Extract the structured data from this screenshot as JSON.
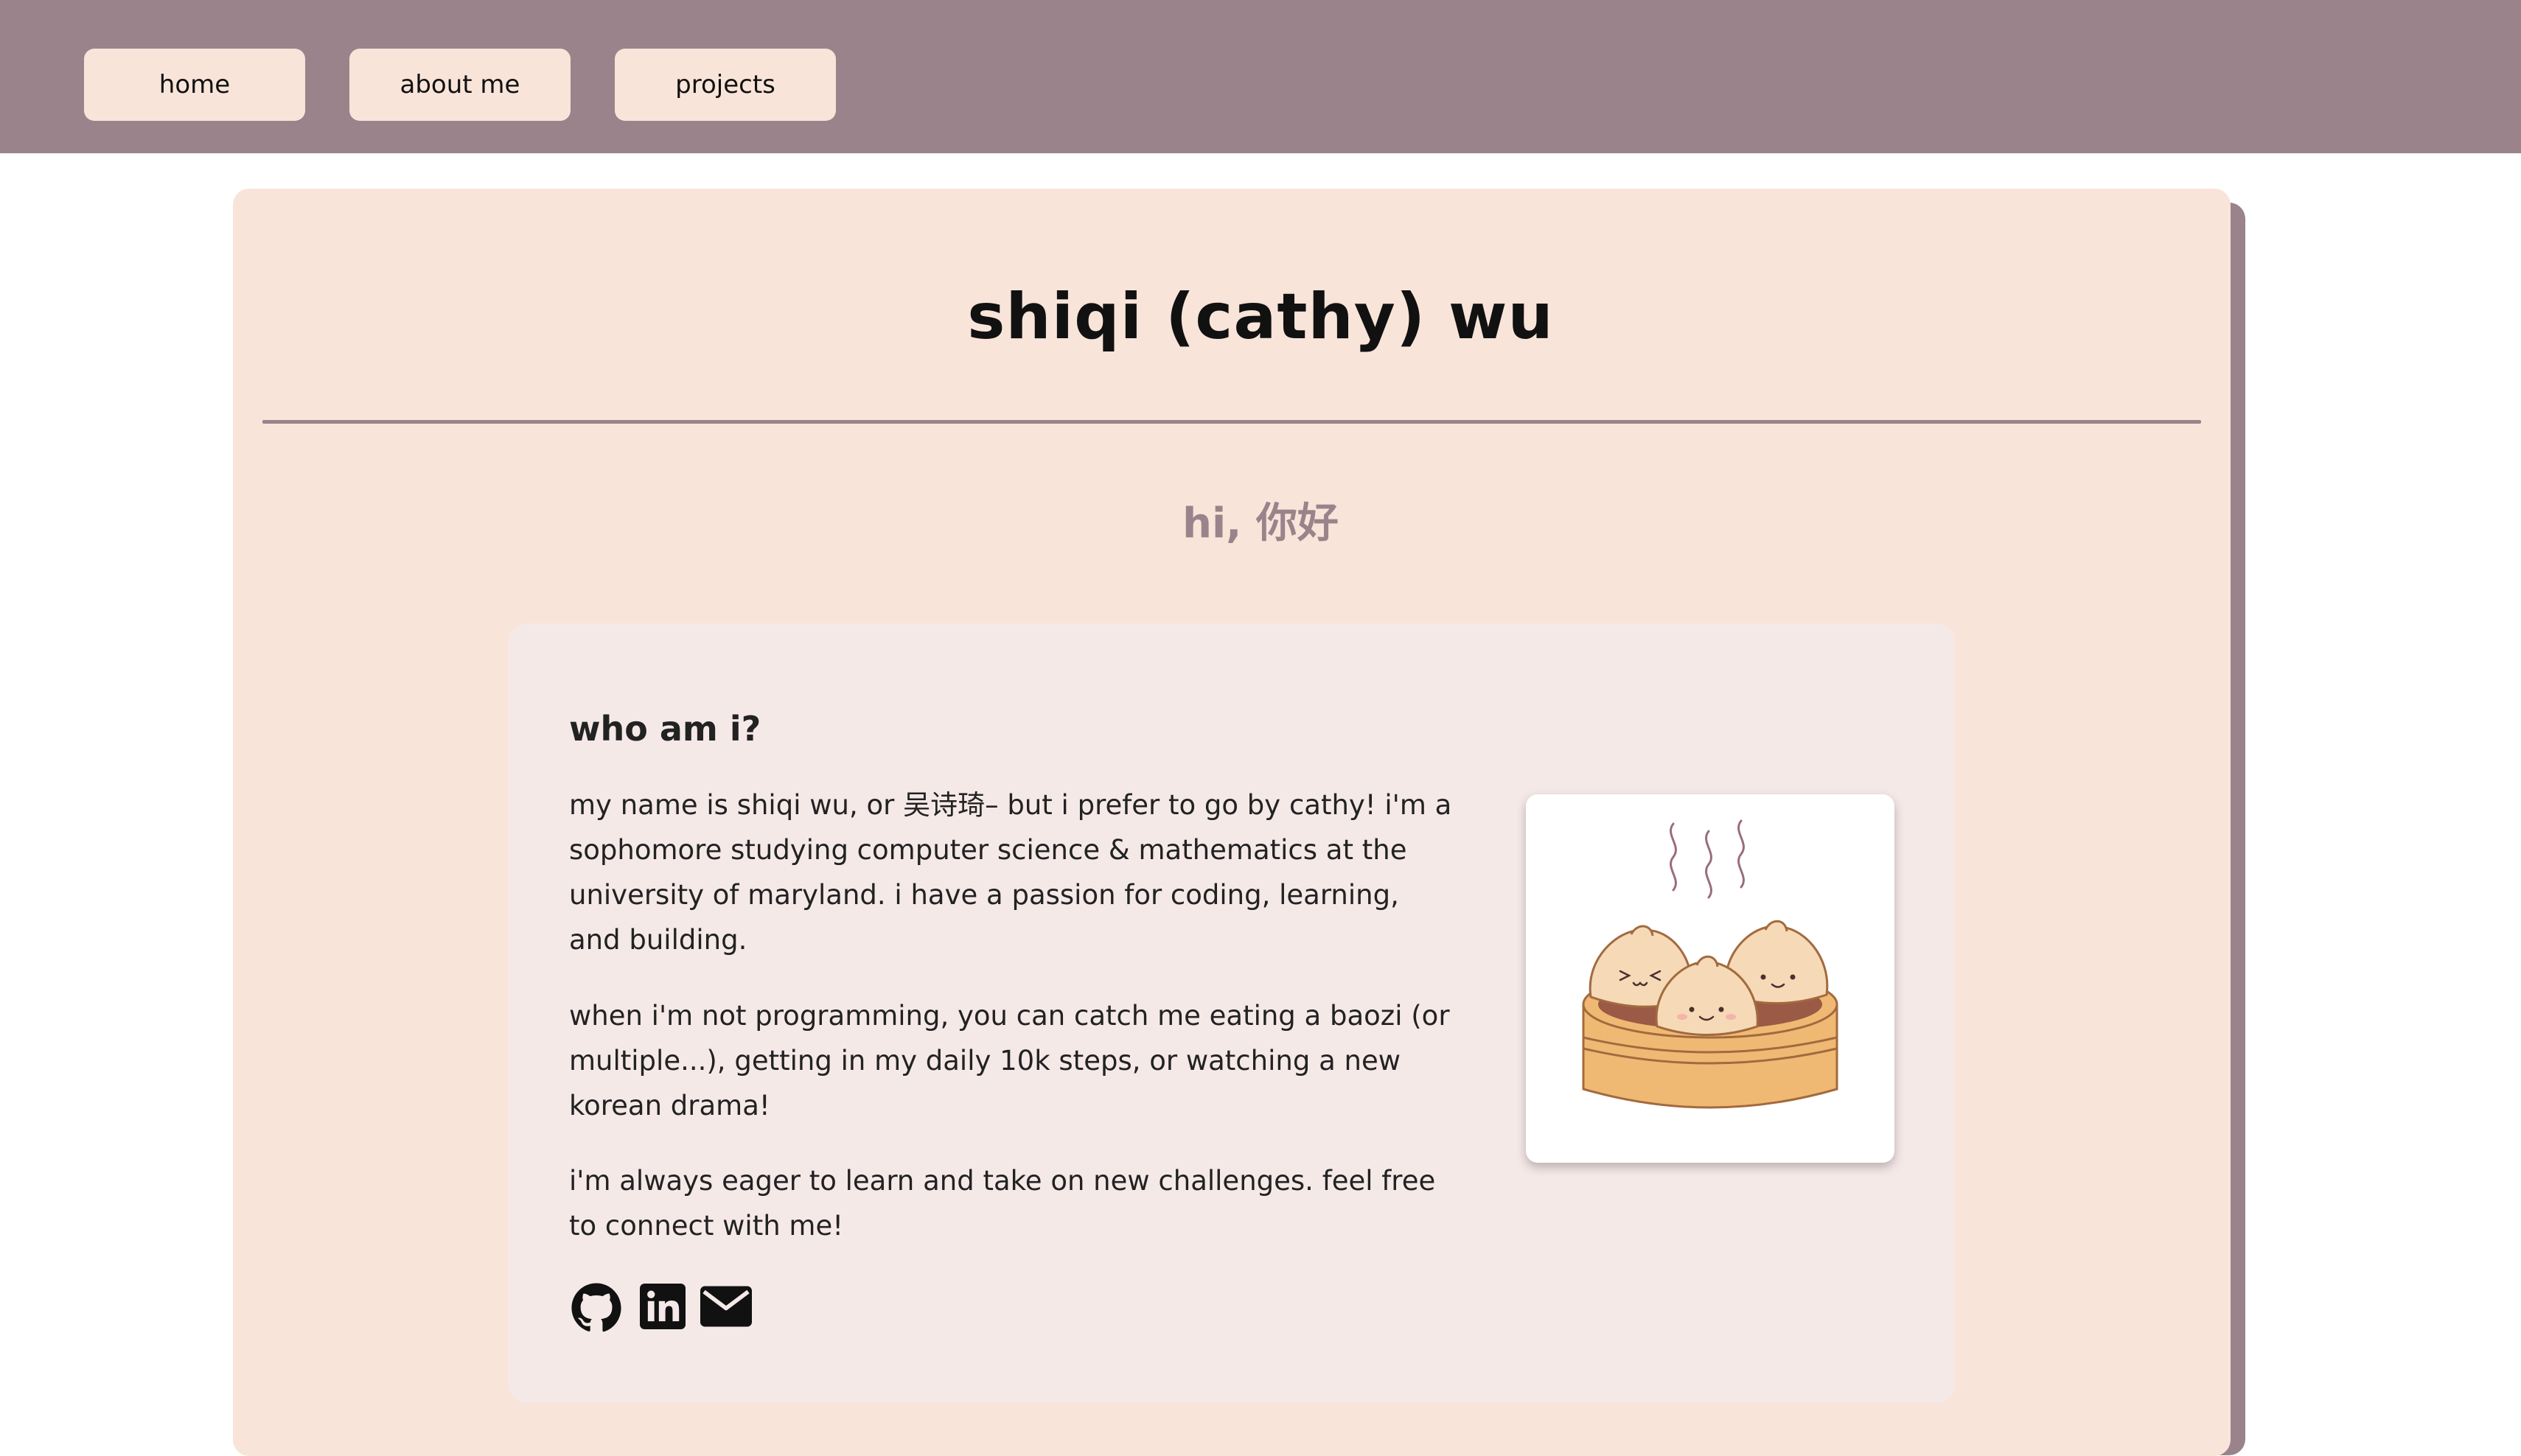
{
  "nav": {
    "home": "home",
    "about": "about me",
    "projects": "projects"
  },
  "header": {
    "title": "shiqi (cathy) wu",
    "greeting": "hi, 你好"
  },
  "about": {
    "heading": "who am i?",
    "p1": "my name is shiqi wu, or 吴诗琦– but i prefer to go by cathy! i'm a sophomore studying computer science & mathematics at the university of maryland. i have a passion for coding, learning, and building.",
    "p2": "when i'm not programming, you can catch me eating a baozi (or multiple...), getting in my daily 10k steps, or watching a new korean drama!",
    "p3": "i'm always eager to learn and take on new challenges. feel free to connect with me!"
  },
  "social_icons": [
    "github-icon",
    "linkedin-icon",
    "email-icon"
  ],
  "image": {
    "subject": "steamer basket with three smiling dumplings"
  },
  "colors": {
    "topbar": "#9a838a",
    "card": "#f9e4da",
    "inner_card": "#f5e9e8",
    "accent": "#9a838a"
  }
}
